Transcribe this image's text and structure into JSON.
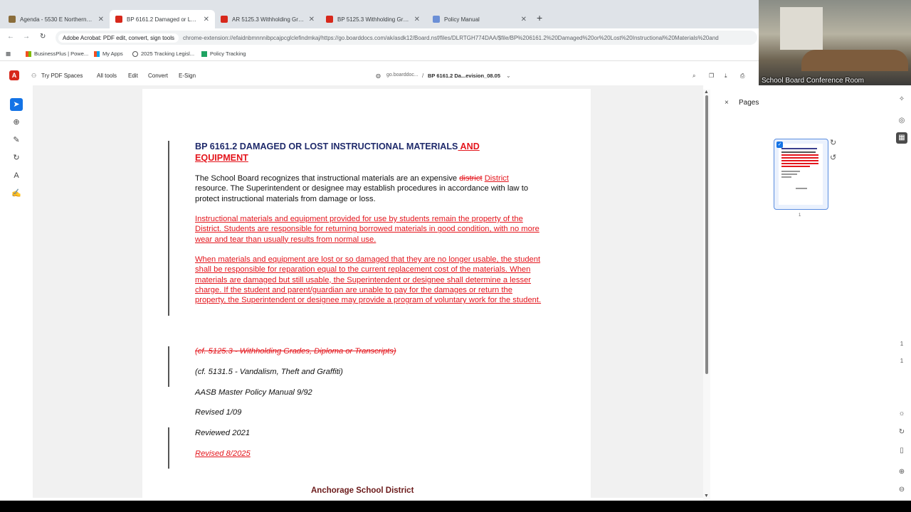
{
  "tabs": [
    {
      "label": "Agenda - 5530 E Northern Ligh",
      "active": false,
      "color": "#8a6d3b"
    },
    {
      "label": "BP 6161.2 Damaged or Lost Ins",
      "active": true,
      "color": "#d7281b"
    },
    {
      "label": "AR 5125.3 Withholding Grades",
      "active": false,
      "color": "#d7281b"
    },
    {
      "label": "BP 5125.3 Withholding Grades",
      "active": false,
      "color": "#d7281b"
    },
    {
      "label": "Policy Manual",
      "active": false,
      "color": "#6b8fd6"
    }
  ],
  "addressbar": {
    "site_chip": "Adobe Acrobat: PDF edit, convert, sign tools",
    "url": "chrome-extension://efaidnbmnnnibpcajpcglclefindmkaj/https://go.boarddocs.com/ak/asdk12/Board.nsf/files/DLRTGH774DAA/$file/BP%206161.2%20Damaged%20or%20Lost%20Instructional%20Materials%20and"
  },
  "bookmarks": [
    "BusinessPlus | Powe...",
    "My Apps",
    "2025 Tracking Legisl...",
    "Policy Tracking"
  ],
  "acrobat": {
    "try": "Try PDF Spaces",
    "menu": [
      "All tools",
      "Edit",
      "Convert",
      "E-Sign"
    ],
    "domain": "go.boarddoc...",
    "separator": "/",
    "filename": "BP 6161.2 Da...evision_08.05"
  },
  "video": {
    "caption": "School Board Conference Room"
  },
  "document": {
    "title_main": "BP 6161.2 DAMAGED OR LOST INSTRUCTIONAL MATERIALS",
    "title_ins_a": " AND",
    "title_ins_b": "EQUIPMENT",
    "p1_a": "The School Board recognizes that instructional materials are an expensive ",
    "p1_del": "district",
    "p1_ins": "District ",
    "p1_b": "resource. The Superintendent or designee may establish procedures in accordance with law to protect instructional materials from damage or loss.",
    "p2": "Instructional materials and equipment provided for use by students remain the property of the District. Students are responsible for returning borrowed materials in good condition, with no more wear and tear than usually results from normal use.",
    "p3": "When materials and equipment are lost or so damaged that they are no longer usable, the student shall be responsible for reparation equal to the current replacement cost of the materials. When materials are damaged but still usable, the Superintendent or designee shall determine a lesser charge. If the student and parent/guardian are unable to pay for the damages or return the property, the Superintendent or designee may provide a program of voluntary work for the student.",
    "cf_deleted": "(cf. 5125.3 - Withholding Grades, Diploma or Transcripts)",
    "cf_vandalism": "(cf. 5131.5 - Vandalism, Theft and Graffiti)",
    "manual": "AASB Master Policy Manual 9/92",
    "revised": "Revised 1/09",
    "reviewed": "Reviewed 2021",
    "revised_new": "Revised 8/2025",
    "footer": "Anchorage School District"
  },
  "pages_panel": {
    "title": "Pages",
    "close": "×",
    "thumb_number": "1"
  },
  "right_rail": {
    "page_current": "1",
    "page_total": "1"
  }
}
